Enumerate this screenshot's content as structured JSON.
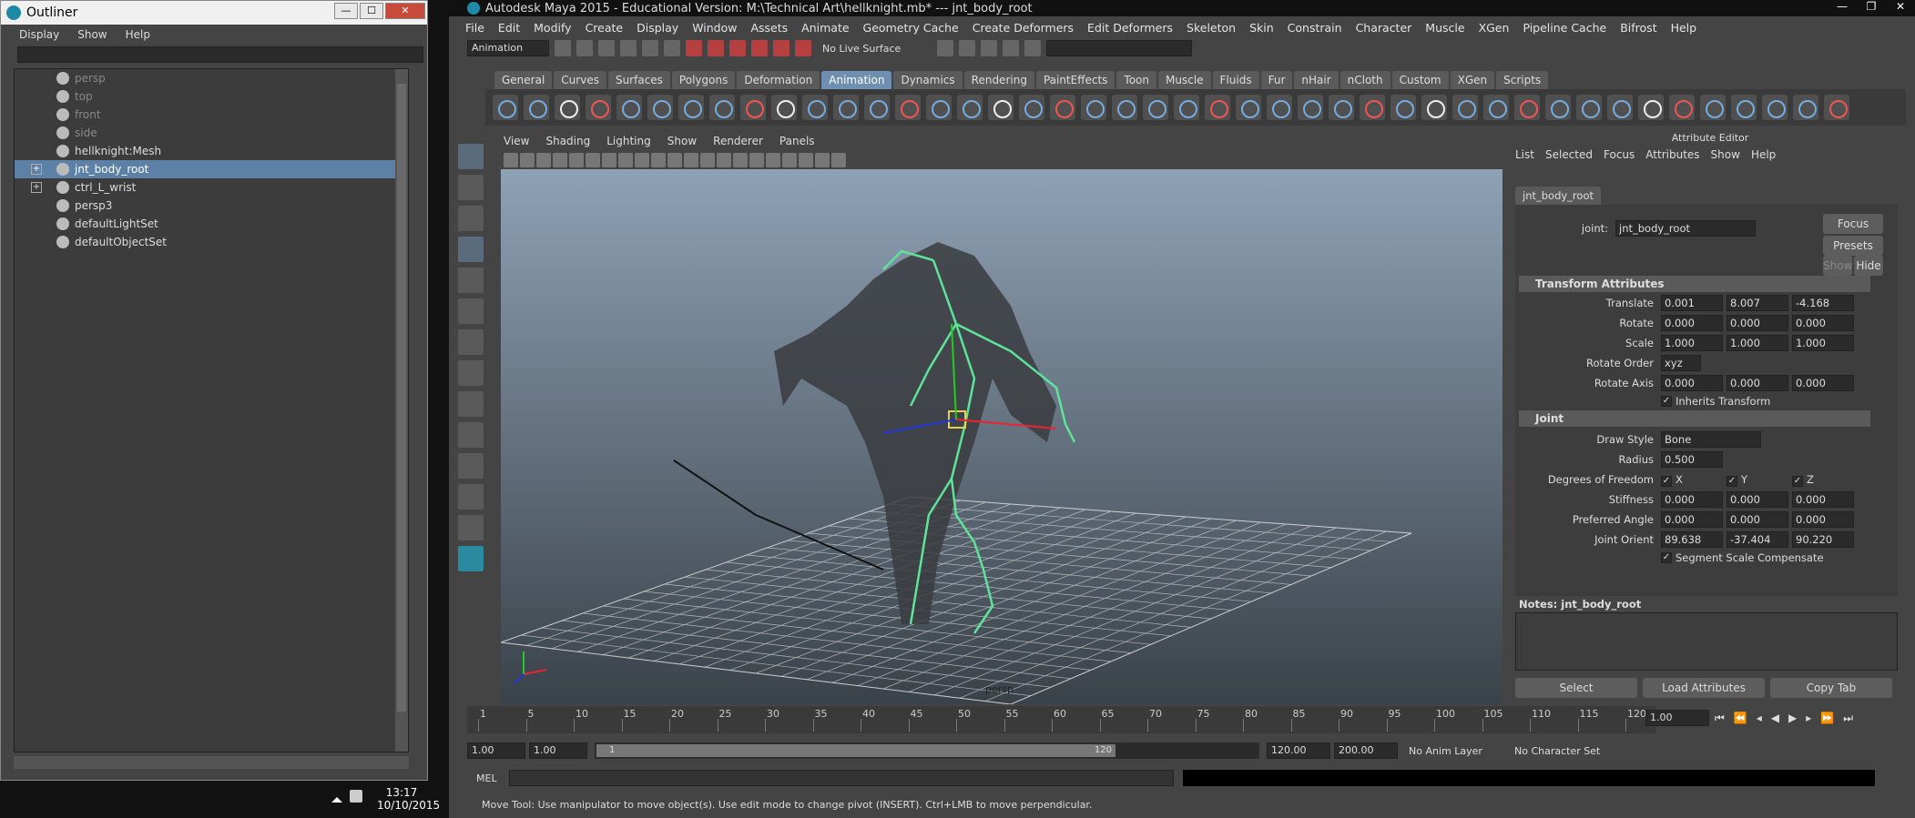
{
  "outliner": {
    "title": "Outliner",
    "menu": [
      "Display",
      "Show",
      "Help"
    ],
    "items": [
      {
        "label": "persp",
        "dim": true
      },
      {
        "label": "top",
        "dim": true
      },
      {
        "label": "front",
        "dim": true
      },
      {
        "label": "side",
        "dim": true
      },
      {
        "label": "hellknight:Mesh",
        "dim": false
      },
      {
        "label": "jnt_body_root",
        "dim": false,
        "selected": true,
        "expandable": true
      },
      {
        "label": "ctrl_L_wrist",
        "dim": false,
        "expandable": true
      },
      {
        "label": "persp3",
        "dim": false
      },
      {
        "label": "defaultLightSet",
        "dim": false
      },
      {
        "label": "defaultObjectSet",
        "dim": false
      }
    ]
  },
  "tray": {
    "time": "13:17",
    "date": "10/10/2015"
  },
  "maya": {
    "title": "Autodesk Maya 2015 - Educational Version: M:\\Technical Art\\hellknight.mb*  ---  jnt_body_root",
    "menus": [
      "File",
      "Edit",
      "Modify",
      "Create",
      "Display",
      "Window",
      "Assets",
      "Animate",
      "Geometry Cache",
      "Create Deformers",
      "Edit Deformers",
      "Skeleton",
      "Skin",
      "Constrain",
      "Character",
      "Muscle",
      "XGen",
      "Pipeline Cache",
      "Bifrost",
      "Help"
    ],
    "menuset": "Animation",
    "live_surface": "No Live Surface",
    "shelf_tabs": [
      "General",
      "Curves",
      "Surfaces",
      "Polygons",
      "Deformation",
      "Animation",
      "Dynamics",
      "Rendering",
      "PaintEffects",
      "Toon",
      "Muscle",
      "Fluids",
      "Fur",
      "nHair",
      "nCloth",
      "Custom",
      "XGen",
      "Scripts"
    ],
    "active_shelf": "Animation",
    "viewport_menu": [
      "View",
      "Shading",
      "Lighting",
      "Show",
      "Renderer",
      "Panels"
    ],
    "viewport_camera": "persp"
  },
  "attr_editor": {
    "title": "Attribute Editor",
    "menu": [
      "List",
      "Selected",
      "Focus",
      "Attributes",
      "Show",
      "Help"
    ],
    "tab": "jnt_body_root",
    "joint_label": "joint:",
    "joint_value": "jnt_body_root",
    "focus": "Focus",
    "presets": "Presets",
    "show": "Show",
    "hide": "Hide",
    "transform_section": "Transform Attributes",
    "translate": {
      "label": "Translate",
      "v": [
        "0.001",
        "8.007",
        "-4.168"
      ]
    },
    "rotate": {
      "label": "Rotate",
      "v": [
        "0.000",
        "0.000",
        "0.000"
      ]
    },
    "scale": {
      "label": "Scale",
      "v": [
        "1.000",
        "1.000",
        "1.000"
      ]
    },
    "rotate_order": {
      "label": "Rotate Order",
      "v": "xyz"
    },
    "rotate_axis": {
      "label": "Rotate Axis",
      "v": [
        "0.000",
        "0.000",
        "0.000"
      ]
    },
    "inherits": "Inherits Transform",
    "joint_section": "Joint",
    "draw_style": {
      "label": "Draw Style",
      "v": "Bone"
    },
    "radius": {
      "label": "Radius",
      "v": "0.500"
    },
    "dof": {
      "label": "Degrees of Freedom",
      "x": "X",
      "y": "Y",
      "z": "Z"
    },
    "stiffness": {
      "label": "Stiffness",
      "v": [
        "0.000",
        "0.000",
        "0.000"
      ]
    },
    "pref_angle": {
      "label": "Preferred Angle",
      "v": [
        "0.000",
        "0.000",
        "0.000"
      ]
    },
    "joint_orient": {
      "label": "Joint Orient",
      "v": [
        "89.638",
        "-37.404",
        "90.220"
      ]
    },
    "segment": "Segment Scale Compensate",
    "notes": "Notes:  jnt_body_root",
    "select": "Select",
    "load": "Load Attributes",
    "copy": "Copy Tab"
  },
  "timeline": {
    "ticks": [
      "1",
      "5",
      "10",
      "15",
      "20",
      "25",
      "30",
      "35",
      "40",
      "45",
      "50",
      "55",
      "60",
      "65",
      "70",
      "75",
      "80",
      "85",
      "90",
      "95",
      "100",
      "105",
      "110",
      "115",
      "120"
    ],
    "current": "1.00"
  },
  "range": {
    "start": "1.00",
    "min": "1.00",
    "slider_start": "1",
    "slider_end": "120",
    "end": "120.00",
    "max": "200.00",
    "anim_layer": "No Anim Layer",
    "char_set": "No Character Set"
  },
  "cmd": {
    "label": "MEL"
  },
  "help": "Move Tool: Use manipulator to move object(s). Use edit mode to change pivot (INSERT).  Ctrl+LMB to move perpendicular."
}
